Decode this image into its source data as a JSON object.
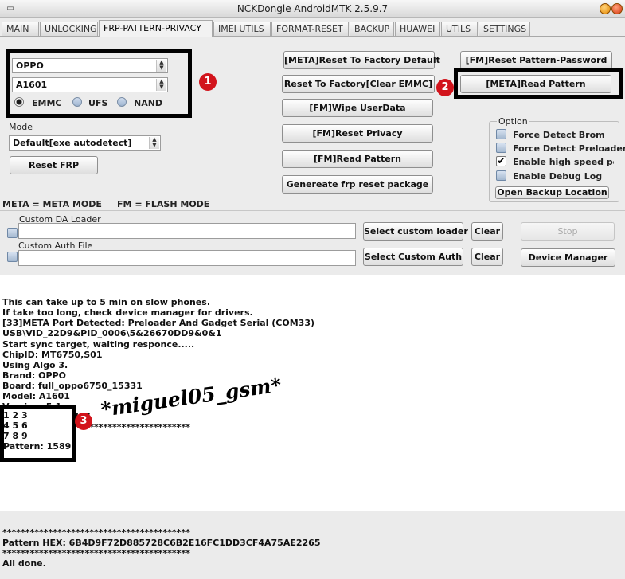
{
  "window": {
    "title": "NCKDongle AndroidMTK 2.5.9.7"
  },
  "tabs": [
    {
      "label": "MAIN"
    },
    {
      "label": "UNLOCKING"
    },
    {
      "label": "FRP-PATTERN-PRIVACY"
    },
    {
      "label": "IMEI UTILS"
    },
    {
      "label": "FORMAT-RESET"
    },
    {
      "label": "BACKUP"
    },
    {
      "label": "HUAWEI"
    },
    {
      "label": "UTILS"
    },
    {
      "label": "SETTINGS"
    }
  ],
  "device": {
    "brand": "OPPO",
    "model": "A1601",
    "storage_options": [
      "EMMC",
      "UFS",
      "NAND"
    ],
    "storage_selected": "EMMC"
  },
  "mode": {
    "label": "Mode",
    "value": "Default[exe autodetect]"
  },
  "buttons": {
    "reset_frp": "Reset FRP",
    "meta_reset_factory": "[META]Reset To Factory Default",
    "reset_factory_emmc": "Reset To Factory[Clear EMMC]",
    "fm_wipe_userdata": "[FM]Wipe UserData",
    "fm_reset_privacy": "[FM]Reset Privacy",
    "fm_read_pattern": "[FM]Read Pattern",
    "generate_frp": "Genereate frp reset package",
    "fm_reset_pattern_password": "[FM]Reset Pattern-Password",
    "meta_read_pattern": "[META]Read Pattern",
    "open_backup": "Open Backup Location",
    "select_custom_loader": "Select custom loader",
    "clear1": "Clear",
    "select_custom_auth": "Select Custom Auth",
    "clear2": "Clear",
    "stop": "Stop",
    "device_manager": "Device Manager"
  },
  "options": {
    "title": "Option",
    "items": [
      {
        "label": "Force Detect Brom",
        "checked": false
      },
      {
        "label": "Force Detect Preloader",
        "checked": false
      },
      {
        "label": "Enable high speed port",
        "checked": true
      },
      {
        "label": "Enable Debug Log",
        "checked": false
      }
    ]
  },
  "legend": "META = META MODE     FM = FLASH MODE",
  "custom": {
    "da_label": "Custom DA Loader",
    "auth_label": "Custom Auth File",
    "da_value": "",
    "auth_value": ""
  },
  "log": {
    "text_top": "This can take up to 5 min on slow phones.\nIf take too long, check device manager for drivers.\n[33]META Port Detected: Preloader And Gadget Serial (COM33)\nUSB\\VID_22D9&PID_0006\\5&26670DD9&0&1\nStart sync target, waiting responce.....\nChipID: MT6750,S01\nUsing Algo 3.\nBrand: OPPO\nBoard: full_oppo6750_15331\nModel: A1601\nVersion: 5.1\nPlatform: MT6755\n*****************************************",
    "pattern_grid": "1 2 3\n4 5 6\n7 8 9\nPattern: 1589",
    "text_bottom": "*****************************************\nPattern HEX: 6B4D9F72D885728C6B2E16FC1DD3CF4A75AE2265\n*****************************************\nAll done."
  },
  "markers": [
    "1",
    "2",
    "3"
  ],
  "watermark": "*miguel05_gsm*",
  "colors": {
    "marker_red": "#d2141c",
    "highlight_box": "#000000"
  }
}
